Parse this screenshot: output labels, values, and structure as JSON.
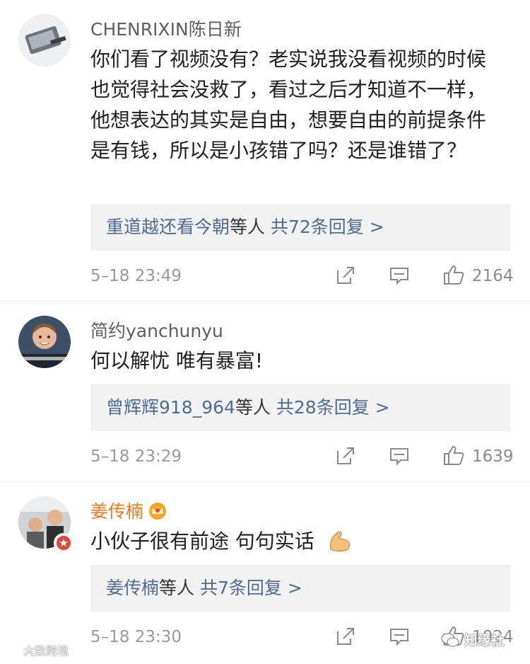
{
  "comments": [
    {
      "username": "CHENRIXIN陈日新",
      "text": "你们看了视频没有？老实说我没看视频的时候也觉得社会没救了，看过之后才知道不一样，他想表达的其实是自由，想要自由的前提条件是有钱，所以是小孩错了吗？还是谁错了？",
      "reply_names": "重道越还看今朝",
      "reply_suffix": "等人",
      "reply_count": "共72条回复 >",
      "timestamp": "5–18 23:49",
      "likes": "2164",
      "avatar_icon": "device-photo-avatar"
    },
    {
      "username": "简约yanchunyu",
      "text": "何以解忧 唯有暴富!",
      "reply_names": "曾辉辉918_964",
      "reply_suffix": "等人",
      "reply_count": "共28条回复 >",
      "timestamp": "5–18 23:29",
      "likes": "1639",
      "avatar_icon": "child-photo-avatar"
    },
    {
      "username": "姜传楠",
      "text": "小伙子很有前途 句句实话",
      "reply_names": "姜传楠",
      "reply_suffix": "等人",
      "reply_count": "共7条回复 >",
      "timestamp": "5–18 23:30",
      "likes": "1024",
      "avatar_icon": "car-selfie-avatar",
      "badge_icon": "verified-badge-icon",
      "username_icon": "crown-icon",
      "emoji_icon": "flexed-biceps-icon"
    }
  ],
  "watermarks": {
    "left": "大数跨境",
    "right": "知缘社"
  },
  "colors": {
    "link": "#4e6b94",
    "vip_name": "#f07a1a",
    "reply_bg": "#f2f2f2",
    "meta": "#9a9a9a"
  }
}
